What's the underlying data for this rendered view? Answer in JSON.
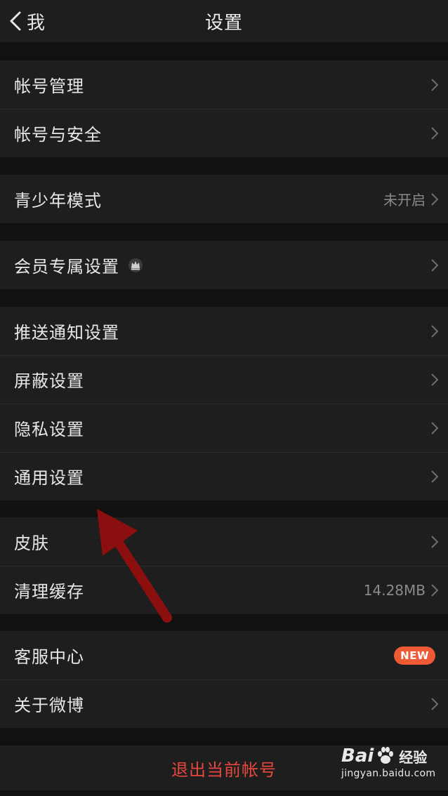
{
  "navbar": {
    "back_label": "我",
    "title": "设置"
  },
  "groups": [
    {
      "items": [
        {
          "label": "帐号管理"
        },
        {
          "label": "帐号与安全"
        }
      ]
    },
    {
      "items": [
        {
          "label": "青少年模式",
          "value": "未开启"
        }
      ]
    },
    {
      "items": [
        {
          "label": "会员专属设置"
        }
      ]
    },
    {
      "items": [
        {
          "label": "推送通知设置"
        },
        {
          "label": "屏蔽设置"
        },
        {
          "label": "隐私设置"
        },
        {
          "label": "通用设置"
        }
      ]
    },
    {
      "items": [
        {
          "label": "皮肤"
        },
        {
          "label": "清理缓存",
          "value": "14.28MB"
        }
      ]
    },
    {
      "items": [
        {
          "label": "客服中心",
          "badge": "NEW"
        },
        {
          "label": "关于微博"
        }
      ]
    }
  ],
  "logout_label": "退出当前帐号",
  "watermark": {
    "brand_left": "Bai",
    "brand_right": "经验",
    "url": "jingyan.baidu.com"
  },
  "colors": {
    "background": "#111111",
    "cell": "#1e1e1e",
    "logout": "#e8473d",
    "badge": "#ee5a35",
    "arrow": "#8b0f0f"
  },
  "icons": [
    "chevron-left-icon",
    "chevron-right-icon",
    "crown-icon",
    "paw-icon"
  ]
}
